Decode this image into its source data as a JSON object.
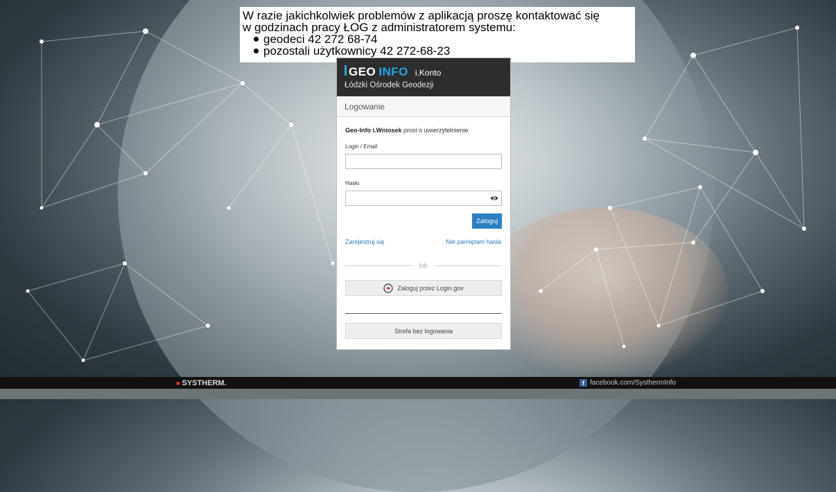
{
  "notice": {
    "line1": "W razie jakichkolwiek problemów z aplikacją proszę kontaktować się",
    "line2": "w godzinach pracy ŁOG z administratorem systemu:",
    "items": [
      "geodeci 42 272 68-74",
      "pozostali użytkownicy 42 272-68-23"
    ]
  },
  "panel": {
    "brand_geo": "GEO",
    "brand_info": "INFO",
    "brand_product": "i.Konto",
    "subtitle": "Łódzki Ośrodek Geodezji",
    "section_title": "Logowanie",
    "auth_app": "Geo-Info i.Wniosek",
    "auth_text": " prosi o uwierzytelnienie",
    "login_label": "Login / Email",
    "login_value": "",
    "password_label": "Hasło",
    "password_value": "",
    "login_button": "Zaloguj",
    "register_link": "Zarejestruj się",
    "forgot_link": "Nie pamiętam hasła",
    "or_text": "lub",
    "gov_button": "Zaloguj przez Login.gov",
    "guest_button": "Strefa bez logowania"
  },
  "footer": {
    "brand": "SYSTHERM.",
    "facebook": "facebook.com/SysthermInfo"
  },
  "colors": {
    "accent": "#2a7fc0",
    "brand_blue": "#23a6e0",
    "header_bg": "#2d2d2d"
  },
  "icons": {
    "eye": "eye-icon",
    "gov": "login-arrow-icon",
    "facebook": "facebook-icon"
  }
}
